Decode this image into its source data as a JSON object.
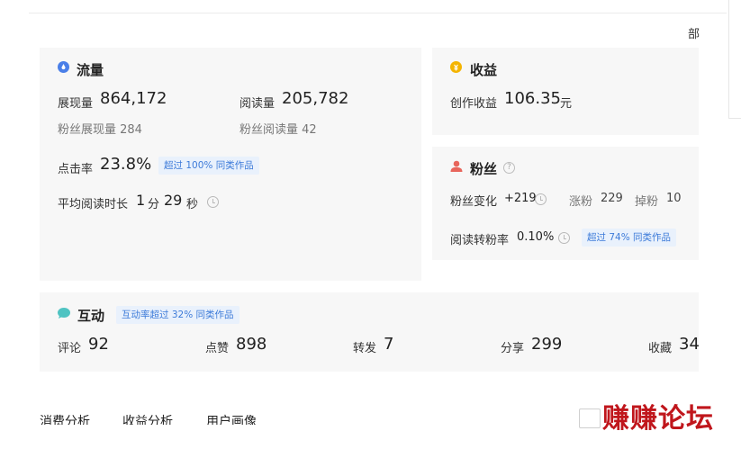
{
  "corner_text": "部",
  "traffic": {
    "title": "流量",
    "impressions_label": "展现量",
    "impressions_value": "864,172",
    "reads_label": "阅读量",
    "reads_value": "205,782",
    "fan_impressions": "粉丝展现量 284",
    "fan_reads": "粉丝阅读量 42",
    "ctr_label": "点击率",
    "ctr_value": "23.8%",
    "ctr_tag": "超过 100% 同类作品",
    "avg_read_label": "平均阅读时长",
    "avg_read_min": "1",
    "min_unit": "分",
    "avg_read_sec": "29",
    "sec_unit": "秒"
  },
  "income": {
    "title": "收益",
    "label": "创作收益",
    "value": "106.35",
    "unit": "元"
  },
  "fans": {
    "title": "粉丝",
    "change_label": "粉丝变化",
    "change_value": "+219",
    "gain_label": "涨粉",
    "gain_value": "229",
    "loss_label": "掉粉",
    "loss_value": "10",
    "conv_label": "阅读转粉率",
    "conv_value": "0.10%",
    "conv_tag": "超过 74% 同类作品"
  },
  "interaction": {
    "title": "互动",
    "tag": "互动率超过 32% 同类作品",
    "comments_label": "评论",
    "comments_value": "92",
    "likes_label": "点赞",
    "likes_value": "898",
    "shares_label": "转发",
    "shares_value": "7",
    "share2_label": "分享",
    "share2_value": "299",
    "fav_label": "收藏",
    "fav_value": "34"
  },
  "tabs": [
    "消费分析",
    "收益分析",
    "用户画像"
  ],
  "watermark": "赚赚论坛",
  "colors": {
    "accent_blue": "#3d7bd9",
    "tag_bg": "#e9f1fc",
    "card_bg": "#f7f7f7",
    "watermark": "#c0161c"
  }
}
